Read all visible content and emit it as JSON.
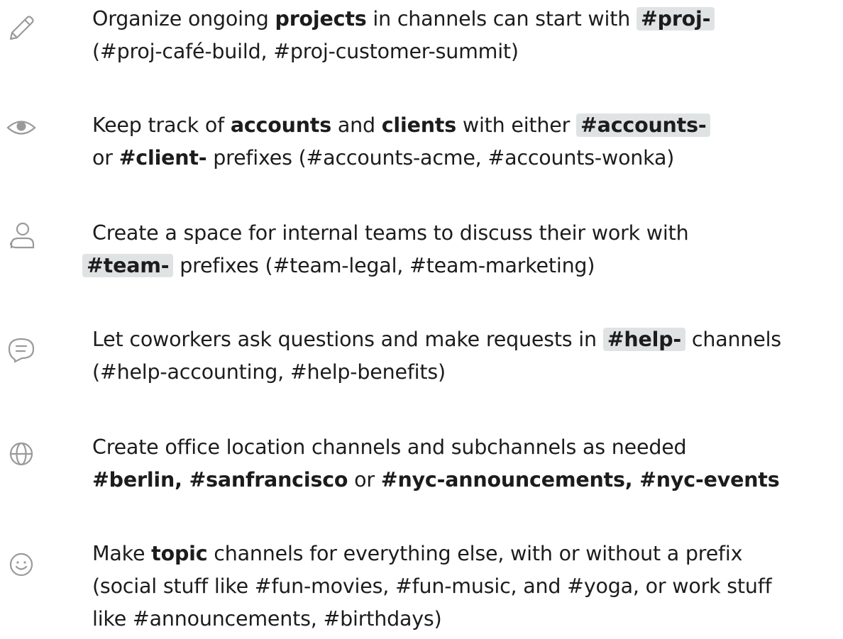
{
  "tips": [
    {
      "icon": "pencil-icon",
      "lines": [
        [
          {
            "t": "Organize ongoing "
          },
          {
            "t": "projects",
            "b": true
          },
          {
            "t": " in channels can start with "
          },
          {
            "t": "#proj-",
            "chip": true
          }
        ],
        [
          {
            "t": "(#proj-café-build, #proj-customer-summit)"
          }
        ]
      ]
    },
    {
      "icon": "eye-icon",
      "lines": [
        [
          {
            "t": "Keep track of "
          },
          {
            "t": "accounts",
            "b": true
          },
          {
            "t": " and "
          },
          {
            "t": "clients",
            "b": true
          },
          {
            "t": " with either "
          },
          {
            "t": "#accounts-",
            "chip": true
          }
        ],
        [
          {
            "t": "or "
          },
          {
            "t": "#client-",
            "b": true
          },
          {
            "t": " prefixes (#accounts-acme, #accounts-wonka)"
          }
        ]
      ]
    },
    {
      "icon": "user-icon",
      "lines": [
        [
          {
            "t": "Create a space for internal teams to discuss their work with"
          }
        ],
        [
          {
            "t": "#team-",
            "chip": true
          },
          {
            "t": " prefixes (#team-legal, #team-marketing)"
          }
        ]
      ]
    },
    {
      "icon": "chat-bubble-icon",
      "lines": [
        [
          {
            "t": "Let coworkers ask questions and make requests in "
          },
          {
            "t": "#help-",
            "chip": true
          },
          {
            "t": " channels"
          }
        ],
        [
          {
            "t": "(#help-accounting, #help-benefits)"
          }
        ]
      ]
    },
    {
      "icon": "globe-icon",
      "lines": [
        [
          {
            "t": "Create office location channels and subchannels as needed"
          }
        ],
        [
          {
            "t": "#berlin, #sanfrancisco",
            "b": true
          },
          {
            "t": " or "
          },
          {
            "t": "#nyc-announcements, #nyc-events",
            "b": true
          }
        ]
      ]
    },
    {
      "icon": "smiley-icon",
      "lines": [
        [
          {
            "t": "Make "
          },
          {
            "t": "topic",
            "b": true
          },
          {
            "t": " channels for everything else, with or without a prefix"
          }
        ],
        [
          {
            "t": "(social stuff like #fun-movies, #fun-music, and #yoga, or work stuff"
          }
        ],
        [
          {
            "t": "like #announcements, #birthdays)"
          }
        ]
      ]
    }
  ]
}
